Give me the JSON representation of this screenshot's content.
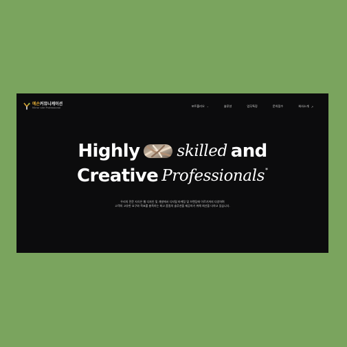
{
  "brand": {
    "name_accent": "예손",
    "name_rest": "커뮤니케이션",
    "tagline": "Mirror site Professional"
  },
  "nav": {
    "items": [
      {
        "label": "포트폴리오",
        "suffix": "⌄",
        "name": "nav-portfolio"
      },
      {
        "label": "솔루션",
        "suffix": "",
        "name": "nav-solution"
      },
      {
        "label": "업무특징",
        "suffix": "",
        "name": "nav-features"
      },
      {
        "label": "문의접수",
        "suffix": "",
        "name": "nav-inquiry"
      },
      {
        "label": "회사소개",
        "suffix": "↗",
        "name": "nav-about"
      }
    ]
  },
  "hero": {
    "line1_word1": "Highly",
    "line1_word2": "skilled",
    "line1_word3": "and",
    "line2_word1": "Creative",
    "line2_word2": "Professionals",
    "asterisk": "*",
    "desc_line1": "우리의 전문 지식은 웹 디자인 및 개발에서 디지털 마케팅 및 브랜딩에 이르기까지 다양하며",
    "desc_line2": "고객의 고유한 요구와 목표를 충족하는 최고 품질의 솔루션을 제공하기 위해 최선을 다하고 있습니다."
  },
  "colors": {
    "page_bg": "#7aa45e",
    "frame_bg": "#0c0c0d",
    "brand_accent": "#d9a535"
  }
}
